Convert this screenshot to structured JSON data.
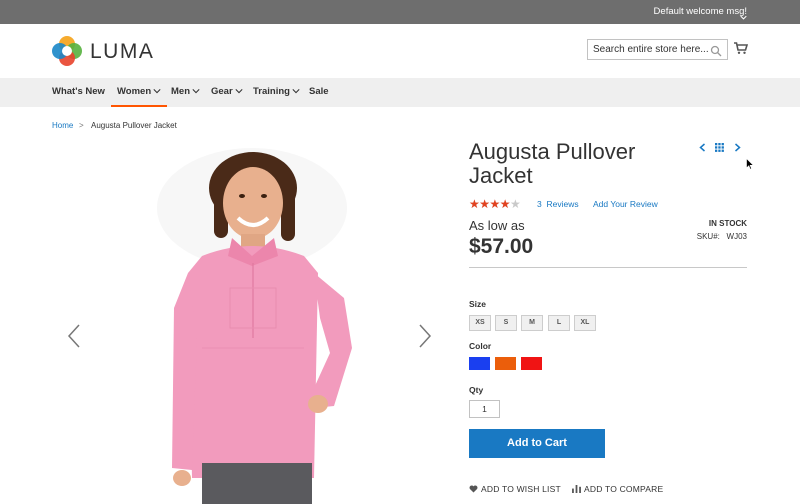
{
  "topbar": {
    "welcome": "Default welcome msg!"
  },
  "header": {
    "logo_text": "LUMA",
    "search_placeholder": "Search entire store here..."
  },
  "nav": {
    "items": [
      {
        "label": "What's New"
      },
      {
        "label": "Women"
      },
      {
        "label": "Men"
      },
      {
        "label": "Gear"
      },
      {
        "label": "Training"
      },
      {
        "label": "Sale"
      }
    ]
  },
  "breadcrumb": {
    "home": "Home",
    "separator": ">",
    "current": "Augusta Pullover Jacket"
  },
  "product": {
    "title": "Augusta Pullover Jacket",
    "rating_stars": "★★★★★",
    "rating": 4,
    "reviews_count": "3",
    "reviews_label": "Reviews",
    "add_review": "Add Your Review",
    "as_low_as": "As low as",
    "price": "$57.00",
    "stock": "IN STOCK",
    "sku_label": "SKU#:",
    "sku": "WJ03",
    "size_label": "Size",
    "sizes": [
      "XS",
      "S",
      "M",
      "L",
      "XL"
    ],
    "color_label": "Color",
    "colors": [
      "#1a3ff0",
      "#eb5e0b",
      "#f01414"
    ],
    "qty_label": "Qty",
    "qty": "1",
    "add_to_cart": "Add to Cart",
    "wishlist": "ADD TO WISH LIST",
    "compare": "ADD TO COMPARE"
  },
  "colors": {
    "accent": "#1979c3",
    "nav_active": "#ff5501",
    "star": "#e24321"
  }
}
